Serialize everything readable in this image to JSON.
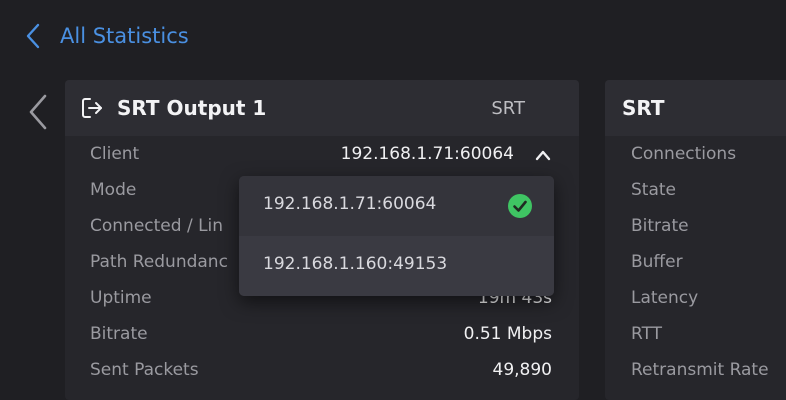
{
  "back": {
    "label": "All Statistics"
  },
  "left_panel": {
    "title": "SRT Output 1",
    "protocol": "SRT",
    "client_label": "Client",
    "client_value": "192.168.1.71:60064",
    "rows": [
      {
        "label": "Mode",
        "value": ""
      },
      {
        "label": "Connected / Lin",
        "value": ""
      },
      {
        "label": "Path Redundanc",
        "value": ""
      },
      {
        "label": "Uptime",
        "value": "19m 43s"
      },
      {
        "label": "Bitrate",
        "value": "0.51 Mbps"
      },
      {
        "label": "Sent Packets",
        "value": "49,890"
      }
    ]
  },
  "client_dropdown": {
    "options": [
      {
        "label": "192.168.1.71:60064",
        "selected": true
      },
      {
        "label": "192.168.1.160:49153",
        "selected": false
      }
    ]
  },
  "right_panel": {
    "title": "SRT",
    "rows": [
      {
        "label": "Connections"
      },
      {
        "label": "State"
      },
      {
        "label": "Bitrate"
      },
      {
        "label": "Buffer"
      },
      {
        "label": "Latency"
      },
      {
        "label": "RTT"
      },
      {
        "label": "Retransmit Rate"
      }
    ]
  },
  "colors": {
    "accent": "#4a90e2",
    "check": "#3fc463",
    "background": "#1f1f23",
    "panel": "#26262b"
  }
}
